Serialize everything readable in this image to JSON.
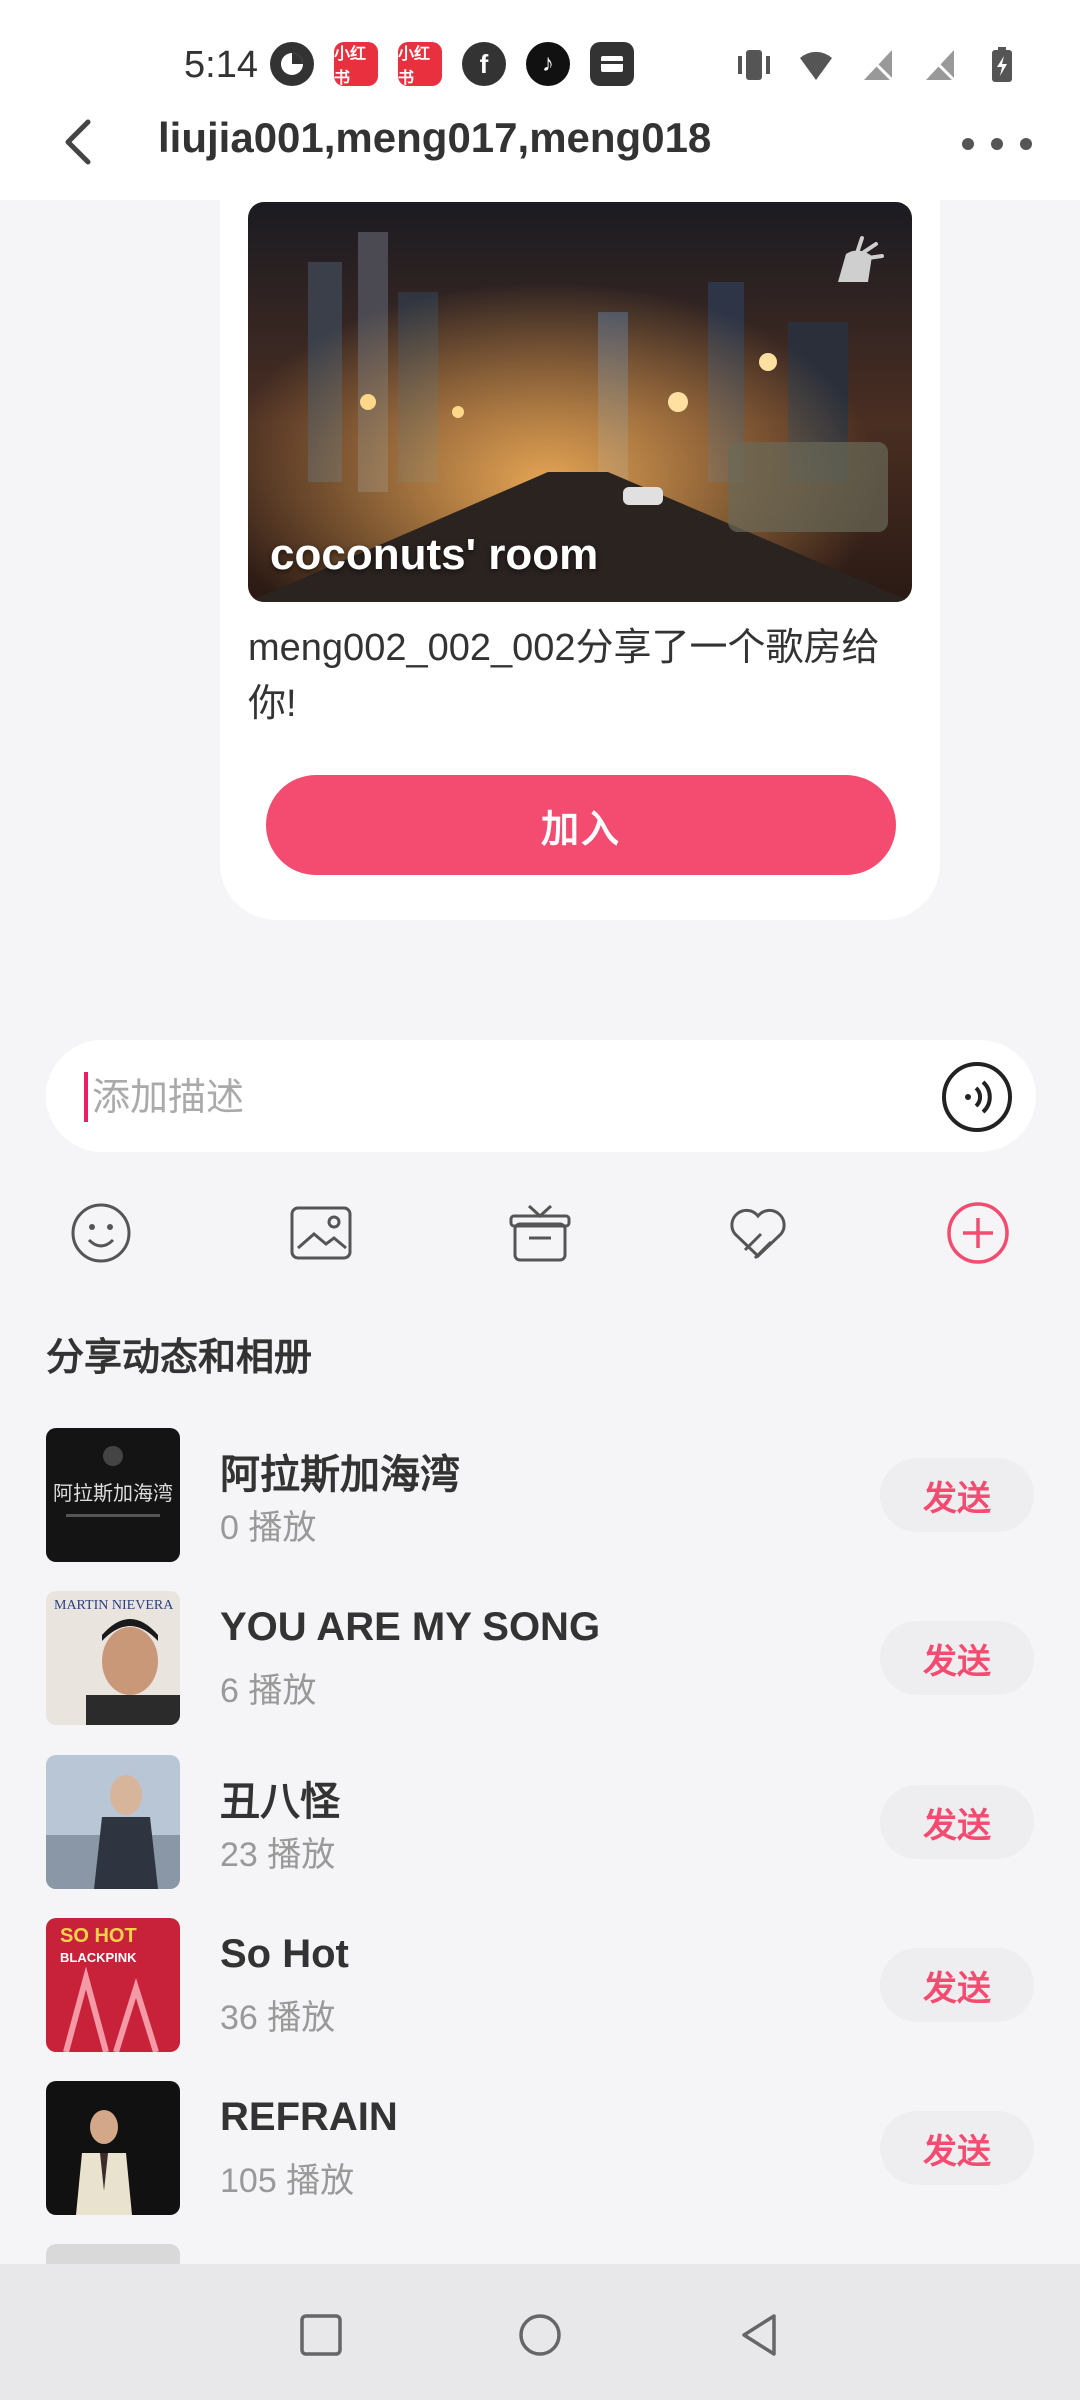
{
  "status_bar": {
    "time": "5:14",
    "app_icons": [
      "pinwheel-icon",
      "xiaohongshu-icon",
      "xiaohongshu-icon",
      "facebook-icon",
      "tiktok-icon",
      "wallet-icon"
    ],
    "right_icons": [
      "vibrate-icon",
      "wifi-icon",
      "no-signal-icon",
      "no-signal-icon",
      "battery-charging-icon"
    ]
  },
  "header": {
    "title": "liujia001,meng017,meng018"
  },
  "room_card": {
    "image_caption": "coconuts' room",
    "message": "meng002_002_002分享了一个歌房给你!",
    "join_label": "加入"
  },
  "composer": {
    "placeholder": "添加描述"
  },
  "toolbar": [
    "emoji-icon",
    "image-icon",
    "gift-icon",
    "heart-shake-icon",
    "add-icon"
  ],
  "section": {
    "title": "分享动态和相册"
  },
  "songs": [
    {
      "title": "阿拉斯加海湾",
      "plays": "0 播放",
      "send": "发送"
    },
    {
      "title": "YOU ARE MY SONG",
      "plays": "6 播放",
      "send": "发送"
    },
    {
      "title": "丑八怪",
      "plays": "23 播放",
      "send": "发送"
    },
    {
      "title": "So Hot",
      "plays": "36 播放",
      "send": "发送"
    },
    {
      "title": "REFRAIN",
      "plays": "105 播放",
      "send": "发送"
    }
  ],
  "colors": {
    "accent": "#f34c70",
    "background": "#f5f5f7"
  }
}
